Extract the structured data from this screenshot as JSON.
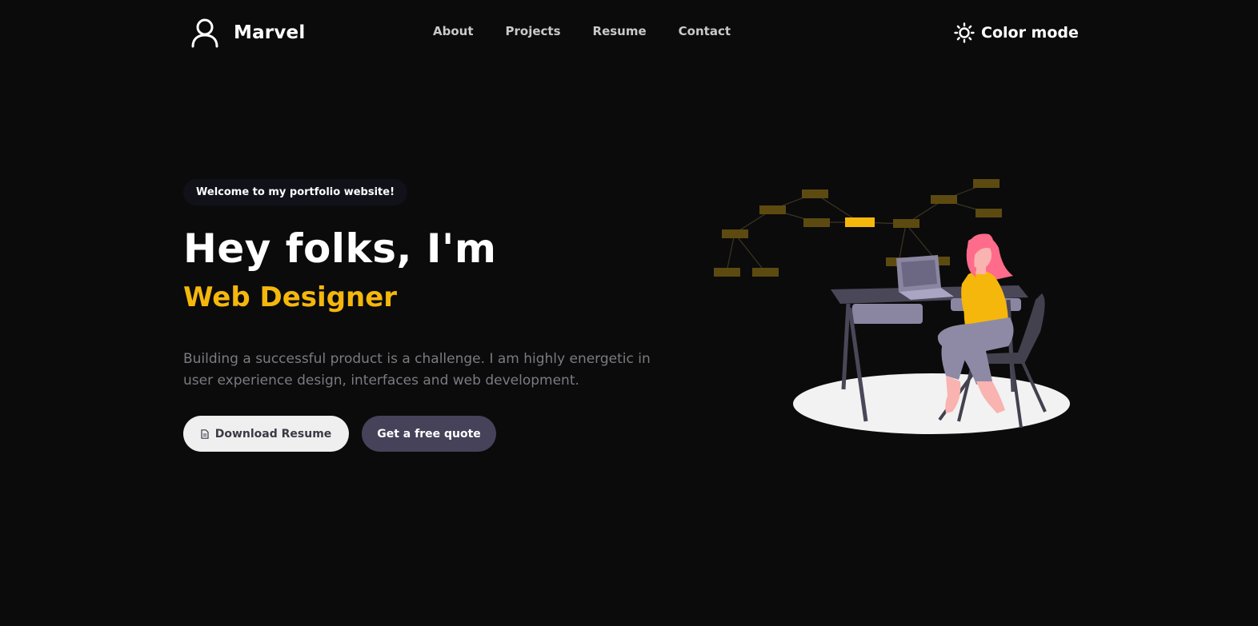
{
  "header": {
    "brand": "Marvel",
    "nav": [
      {
        "label": "About"
      },
      {
        "label": "Projects"
      },
      {
        "label": "Resume"
      },
      {
        "label": "Contact"
      }
    ],
    "color_mode_label": "Color mode"
  },
  "hero": {
    "welcome": "Welcome to my portfolio website!",
    "title": "Hey folks, I'm",
    "role": "Web Designer",
    "description": "Building a successful product is a challenge. I am highly energetic in user experience design, interfaces and web development.",
    "buttons": {
      "download_resume": "Download Resume",
      "free_quote": "Get a free quote"
    }
  },
  "colors": {
    "background": "#0b0b0c",
    "accent": "#f5b70c",
    "secondary_button": "#454259",
    "muted_text": "#7b7b80"
  },
  "icons": {
    "logo": "user-icon",
    "color_mode": "sun-icon",
    "resume": "document-icon"
  }
}
